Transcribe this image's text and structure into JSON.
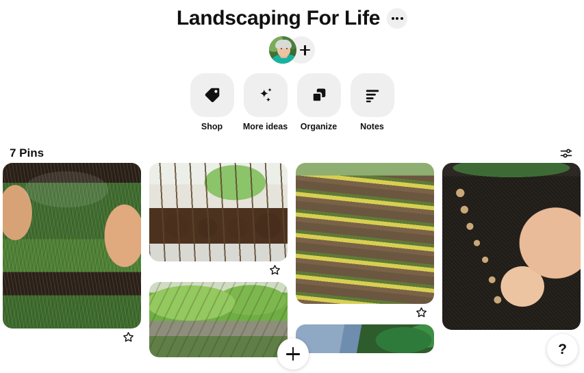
{
  "header": {
    "board_title": "Landscaping For Life",
    "more_options_icon": "ellipsis-icon",
    "avatar_icon": "user-avatar",
    "add_collaborator_icon": "plus-icon"
  },
  "actions": [
    {
      "label": "Shop",
      "icon": "tag-icon"
    },
    {
      "label": "More ideas",
      "icon": "sparkle-icon"
    },
    {
      "label": "Organize",
      "icon": "stacked-squares-icon"
    },
    {
      "label": "Notes",
      "icon": "lines-icon"
    }
  ],
  "pins_bar": {
    "count_label": "7 Pins",
    "filter_icon": "sliders-icon"
  },
  "pins": {
    "col1": [
      {
        "name": "pin-grass-sod",
        "alt": "Hands planting green grass sod in soil",
        "favorite_icon": "star-outline-icon"
      }
    ],
    "col2": [
      {
        "name": "pin-seedling-pots",
        "alt": "Tray of seedling pots with sprouts and markers",
        "favorite_icon": "star-outline-icon"
      },
      {
        "name": "pin-pergola-vines",
        "alt": "Wooden pergola covered with green climbing vines",
        "favorite_icon": ""
      }
    ],
    "col3": [
      {
        "name": "pin-stone-garden-steps",
        "alt": "Stone garden steps with moss and planters",
        "favorite_icon": "star-outline-icon"
      },
      {
        "name": "pin-gardener-jeans",
        "alt": "Person in blue jeans kneeling by green plants",
        "favorite_icon": ""
      }
    ],
    "col4": [
      {
        "name": "pin-planting-seeds",
        "alt": "Hand placing seeds in a row in dark soil",
        "favorite_icon": ""
      }
    ]
  },
  "floating": {
    "create_icon": "plus-icon",
    "help_label": "?"
  },
  "colors": {
    "button_bg": "#efefef",
    "text": "#111111",
    "page_bg": "#ffffff"
  }
}
